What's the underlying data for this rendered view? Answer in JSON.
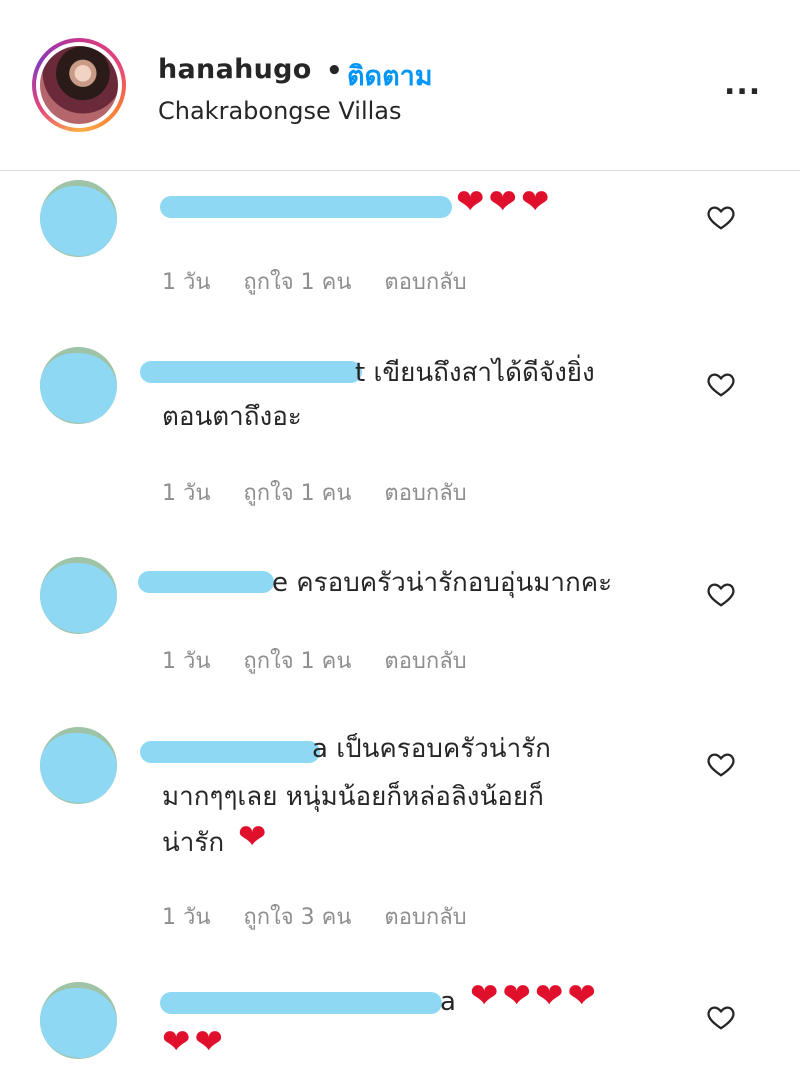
{
  "header": {
    "username": "hanahugo",
    "separator": "•",
    "follow_label": "ติดตาม",
    "location": "Chakrabongse Villas",
    "more_label": "..."
  },
  "comments": [
    {
      "text": "",
      "hearts": "❤❤❤",
      "time": "1 วัน",
      "likes": "ถูกใจ 1 คน",
      "reply": "ตอบกลับ"
    },
    {
      "text": "t เขียนถึงสาได้ดีจังยิ่ง",
      "text2": "ตอนตาถึงอะ",
      "time": "1 วัน",
      "likes": "ถูกใจ 1 คน",
      "reply": "ตอบกลับ"
    },
    {
      "text": "e ครอบครัวน่ารักอบอุ่นมากคะ",
      "time": "1 วัน",
      "likes": "ถูกใจ 1 คน",
      "reply": "ตอบกลับ"
    },
    {
      "text": "a เป็นครอบครัวน่ารัก",
      "text2": "มากๆๆเลย หนุ่มน้อยก็หล่อลิงน้อยก็",
      "text3": "น่ารัก",
      "hearts": "❤",
      "time": "1 วัน",
      "likes": "ถูกใจ 3 คน",
      "reply": "ตอบกลับ"
    },
    {
      "text": "a",
      "hearts": "❤❤❤❤",
      "hearts2": "❤❤"
    }
  ],
  "colors": {
    "accent": "#0095f6",
    "heart": "#e0102c",
    "mask": "#8fd8f3",
    "meta": "#8e8e8e"
  },
  "icons": {
    "like": "heart-outline-icon",
    "more": "more-icon"
  }
}
